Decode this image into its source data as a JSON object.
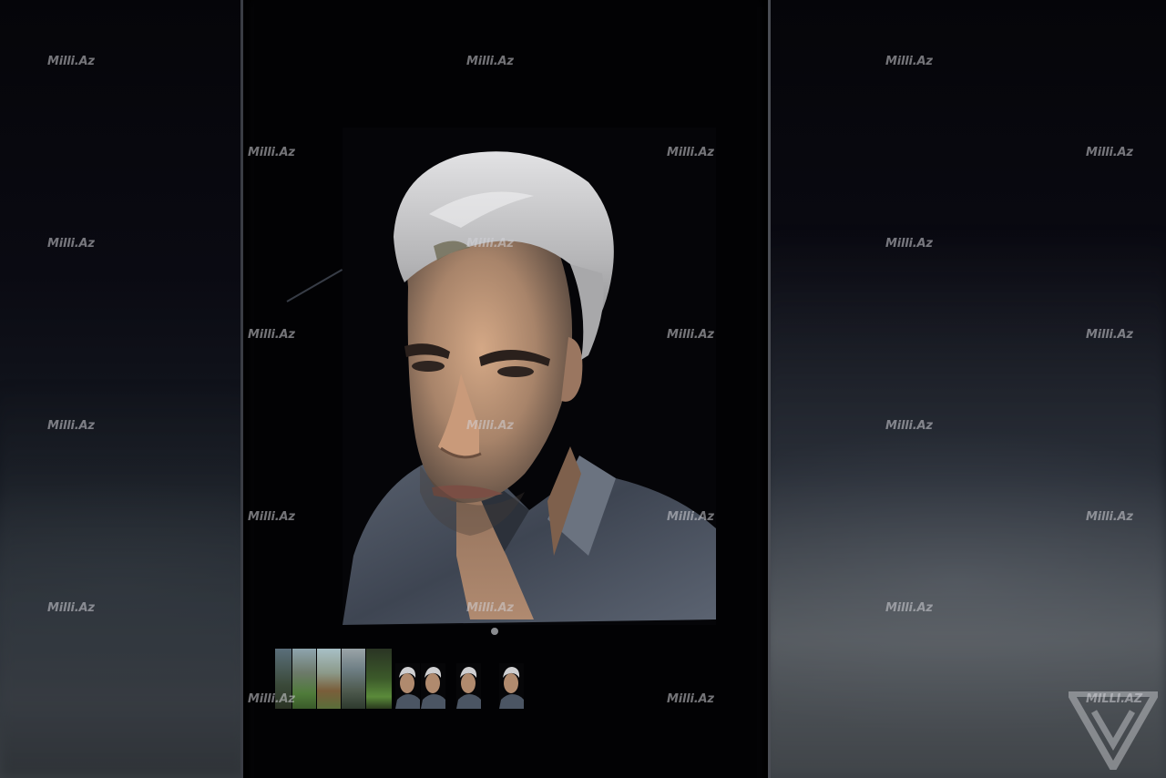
{
  "scene": {
    "description_tag": "stage-photo-of-phone",
    "watermark_text": "Milli.Az",
    "corner_watermark_text": "MILLI.AZ"
  },
  "colors": {
    "background": "#07070d",
    "phone_bezel": "#3a3d44",
    "shirt": "#4b5563",
    "hair": "#c9c9cb",
    "skin": "#b08a6e"
  },
  "thumbnails": {
    "landscapes": [
      "landscape-thumb-1",
      "landscape-thumb-2",
      "landscape-thumb-3",
      "landscape-thumb-4",
      "landscape-thumb-5"
    ],
    "faces": [
      "face-thumb-1",
      "face-thumb-2",
      "face-thumb-3",
      "face-thumb-4"
    ]
  },
  "logo": {
    "icon": "verge-triangle-icon"
  }
}
